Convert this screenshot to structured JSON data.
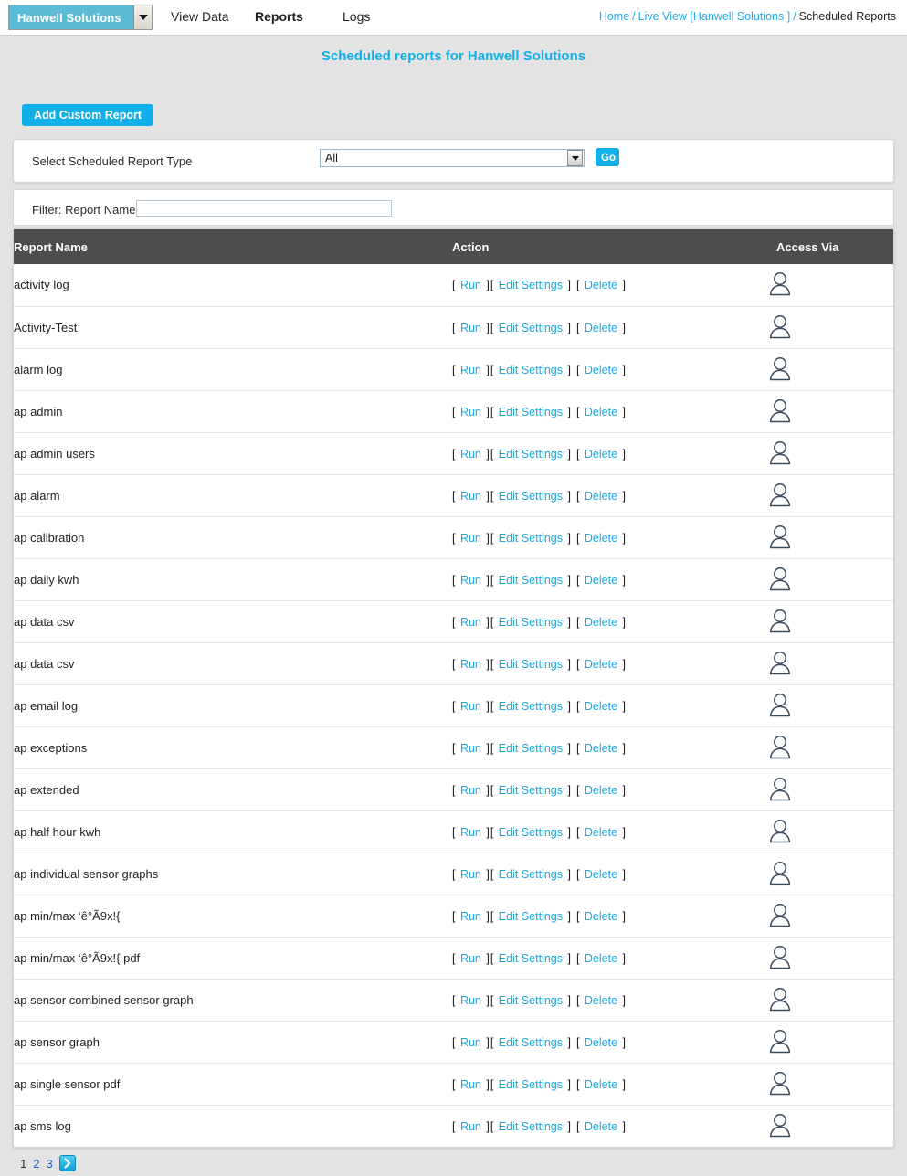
{
  "topnav": {
    "org_selector": {
      "label": "Hanwell Solutions",
      "icon": "chevron-down-icon"
    },
    "items": [
      {
        "label": "View Data",
        "active": false
      },
      {
        "label": "Reports",
        "active": true
      },
      {
        "label": "Logs",
        "active": false
      }
    ]
  },
  "breadcrumb": {
    "items": [
      "Home",
      "Live View [Hanwell Solutions ]"
    ],
    "separator": "/",
    "current": "Scheduled Reports"
  },
  "page_title": "Scheduled reports for Hanwell Solutions",
  "toolbar": {
    "add_custom_report_label": "Add Custom Report"
  },
  "report_type_panel": {
    "label": "Select Scheduled Report Type",
    "selected": "All",
    "go_label": "Go"
  },
  "filter_panel": {
    "label": "Filter: Report Name",
    "value": "",
    "placeholder": ""
  },
  "table": {
    "headers": {
      "name": "Report Name",
      "action": "Action",
      "access": "Access Via"
    },
    "actions": {
      "run": "Run",
      "edit_settings": "Edit Settings",
      "delete": "Delete",
      "bracket_open": "[",
      "bracket_close": "]"
    },
    "access_icon": "user-icon",
    "rows": [
      {
        "name": "activity log"
      },
      {
        "name": "Activity-Test"
      },
      {
        "name": "alarm log"
      },
      {
        "name": "ap admin"
      },
      {
        "name": "ap admin users"
      },
      {
        "name": "ap alarm"
      },
      {
        "name": "ap calibration"
      },
      {
        "name": "ap daily kwh"
      },
      {
        "name": "ap data csv"
      },
      {
        "name": "ap data csv"
      },
      {
        "name": "ap email log"
      },
      {
        "name": "ap exceptions"
      },
      {
        "name": "ap extended"
      },
      {
        "name": "ap half hour kwh"
      },
      {
        "name": "ap individual sensor graphs"
      },
      {
        "name": "ap min/max ‘ê°Ã9x!{"
      },
      {
        "name": "ap min/max ‘ê°Ã9x!{ pdf"
      },
      {
        "name": "ap sensor combined sensor graph"
      },
      {
        "name": "ap sensor graph"
      },
      {
        "name": "ap single sensor pdf"
      },
      {
        "name": "ap sms log"
      }
    ]
  },
  "pagination": {
    "pages": [
      "1",
      "2",
      "3"
    ],
    "current": "1",
    "next_icon": "chevron-right-icon"
  },
  "colors": {
    "accent": "#12b0e8",
    "link": "#1ba8dd",
    "header_bar": "#4d4d4d",
    "org_selector": "#5cbcd8",
    "page_bg": "#e3e3e3"
  }
}
